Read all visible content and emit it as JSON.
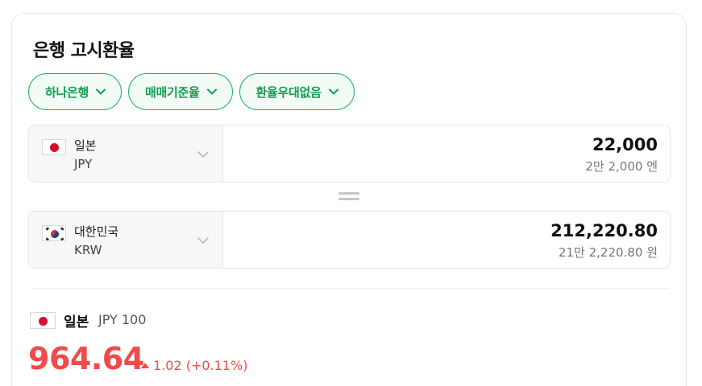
{
  "title": "은행 고시환율",
  "chips": [
    {
      "label": "하나은행"
    },
    {
      "label": "매매기준율"
    },
    {
      "label": "환율우대없음"
    }
  ],
  "from": {
    "name": "일본",
    "code": "JPY",
    "amount": "22,000",
    "amount_korean": "2만 2,000 엔",
    "flag": "jp-flag"
  },
  "to": {
    "name": "대한민국",
    "code": "KRW",
    "amount": "212,220.80",
    "amount_korean": "21만 2,220.80 원",
    "flag": "kr-flag"
  },
  "summary": {
    "name": "일본",
    "unit": "JPY 100",
    "rate": "964.64",
    "change": "1.02 (+0.11%)"
  },
  "colors": {
    "accent_green": "#17b55e",
    "up_red": "#f04b4b"
  }
}
